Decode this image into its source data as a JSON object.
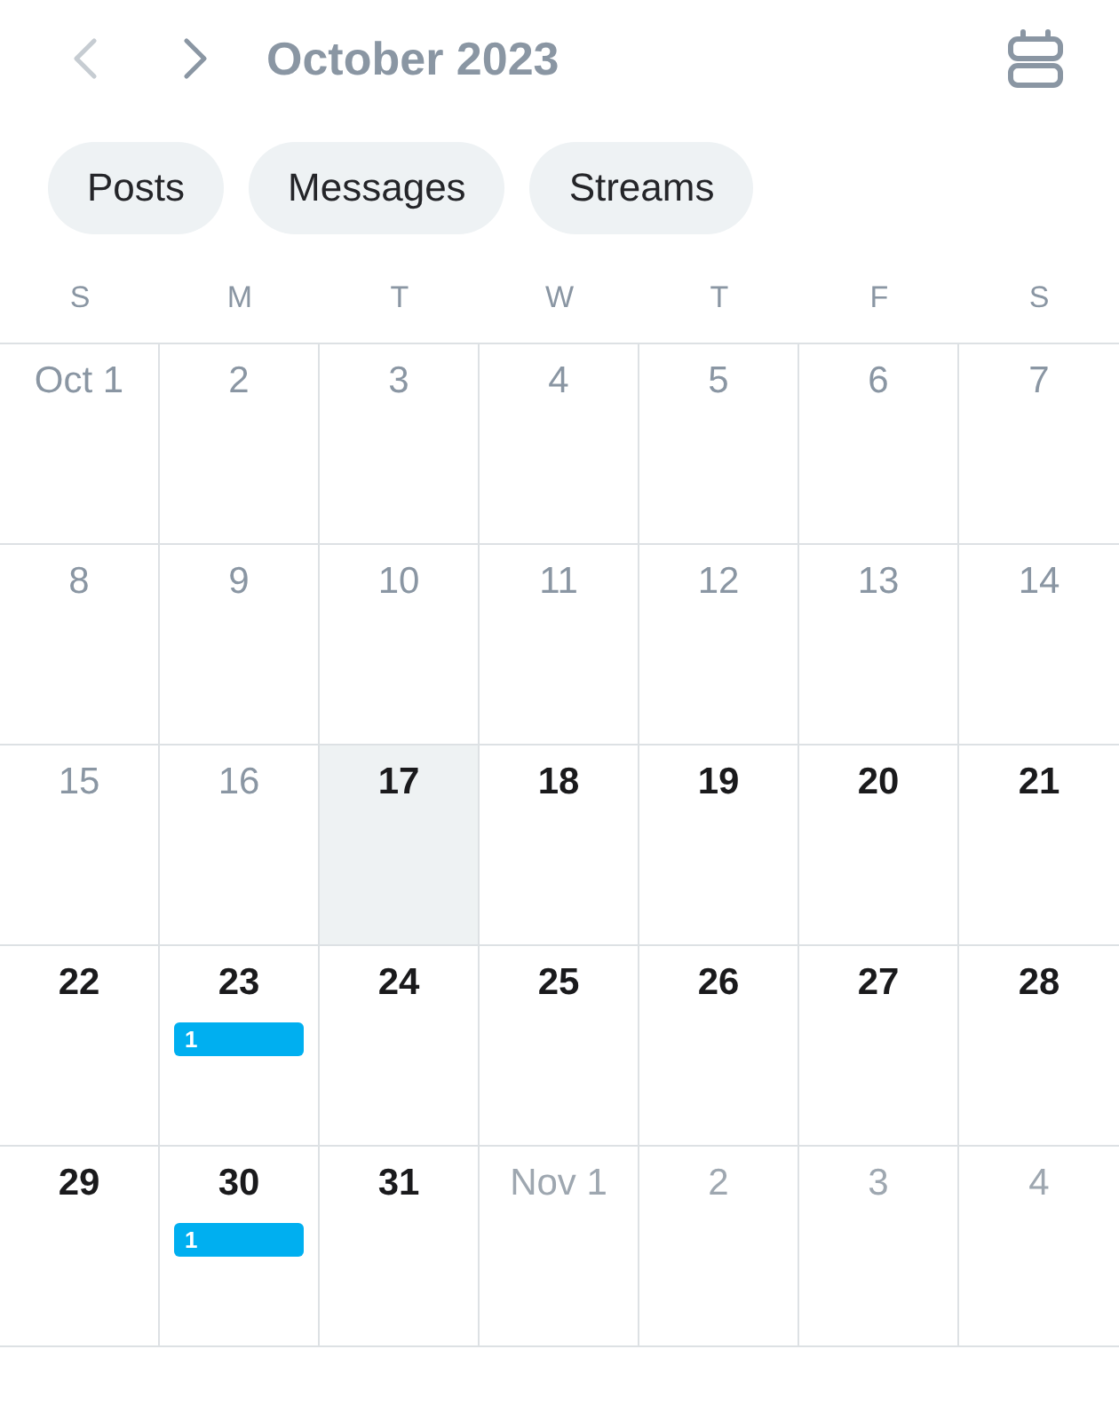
{
  "header": {
    "prev": {
      "disabled": true
    },
    "next": {
      "disabled": false
    },
    "title": "October 2023"
  },
  "filters": [
    {
      "label": "Posts",
      "selected": false
    },
    {
      "label": "Messages",
      "selected": false
    },
    {
      "label": "Streams",
      "selected": false
    }
  ],
  "weekdays": [
    "S",
    "M",
    "T",
    "W",
    "T",
    "F",
    "S"
  ],
  "weeks": [
    [
      {
        "label": "Oct 1",
        "kind": "past"
      },
      {
        "label": "2",
        "kind": "past"
      },
      {
        "label": "3",
        "kind": "past"
      },
      {
        "label": "4",
        "kind": "past"
      },
      {
        "label": "5",
        "kind": "past"
      },
      {
        "label": "6",
        "kind": "past"
      },
      {
        "label": "7",
        "kind": "past"
      }
    ],
    [
      {
        "label": "8",
        "kind": "past"
      },
      {
        "label": "9",
        "kind": "past"
      },
      {
        "label": "10",
        "kind": "past"
      },
      {
        "label": "11",
        "kind": "past"
      },
      {
        "label": "12",
        "kind": "past"
      },
      {
        "label": "13",
        "kind": "past"
      },
      {
        "label": "14",
        "kind": "past"
      }
    ],
    [
      {
        "label": "15",
        "kind": "past"
      },
      {
        "label": "16",
        "kind": "past"
      },
      {
        "label": "17",
        "kind": "today"
      },
      {
        "label": "18",
        "kind": "upcoming"
      },
      {
        "label": "19",
        "kind": "upcoming"
      },
      {
        "label": "20",
        "kind": "upcoming"
      },
      {
        "label": "21",
        "kind": "upcoming"
      }
    ],
    [
      {
        "label": "22",
        "kind": "upcoming"
      },
      {
        "label": "23",
        "kind": "upcoming",
        "badge": "1"
      },
      {
        "label": "24",
        "kind": "upcoming"
      },
      {
        "label": "25",
        "kind": "upcoming"
      },
      {
        "label": "26",
        "kind": "upcoming"
      },
      {
        "label": "27",
        "kind": "upcoming"
      },
      {
        "label": "28",
        "kind": "upcoming"
      }
    ],
    [
      {
        "label": "29",
        "kind": "upcoming"
      },
      {
        "label": "30",
        "kind": "upcoming",
        "badge": "1"
      },
      {
        "label": "31",
        "kind": "upcoming"
      },
      {
        "label": "Nov 1",
        "kind": "outside"
      },
      {
        "label": "2",
        "kind": "outside"
      },
      {
        "label": "3",
        "kind": "outside"
      },
      {
        "label": "4",
        "kind": "outside"
      }
    ]
  ]
}
